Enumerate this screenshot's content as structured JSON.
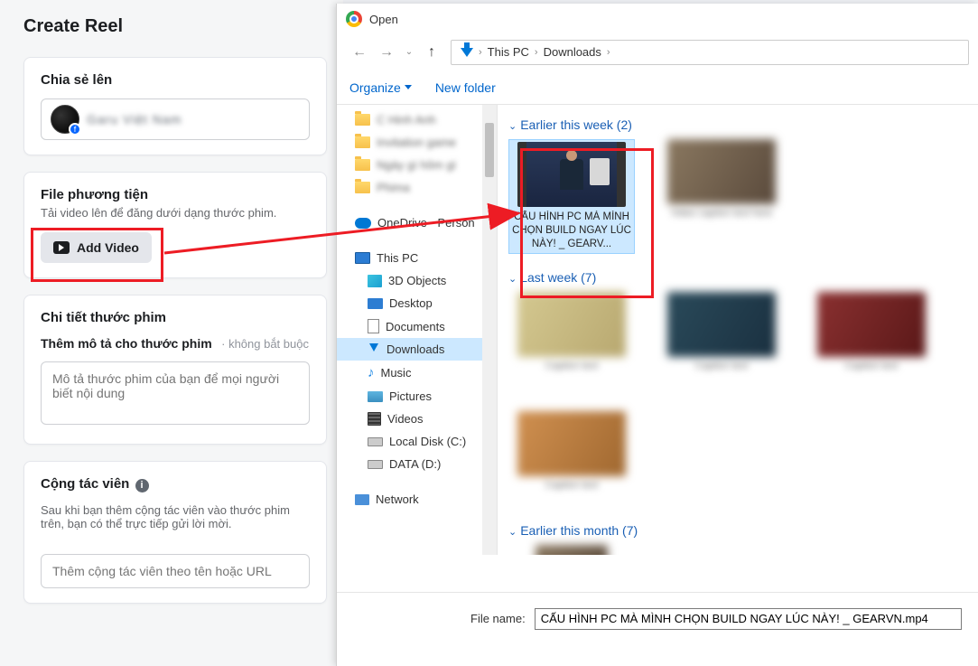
{
  "page": {
    "title": "Create Reel"
  },
  "share": {
    "heading": "Chia sẻ lên",
    "account": "Garu Việt Nam"
  },
  "media": {
    "heading": "File phương tiện",
    "subtitle": "Tải video lên để đăng dưới dạng thước phim.",
    "add_btn": "Add Video"
  },
  "details": {
    "heading": "Chi tiết thước phim",
    "desc_label": "Thêm mô tả cho thước phim",
    "optional": "không bắt buộc",
    "desc_placeholder": "Mô tả thước phim của bạn để mọi người biết nội dung"
  },
  "collab": {
    "heading": "Cộng tác viên",
    "text": "Sau khi bạn thêm cộng tác viên vào thước phim trên, bạn có thể trực tiếp gửi lời mời.",
    "placeholder": "Thêm cộng tác viên theo tên hoặc URL"
  },
  "dialog": {
    "title": "Open",
    "crumbs": [
      "This PC",
      "Downloads"
    ],
    "toolbar": {
      "organize": "Organize",
      "newfolder": "New folder"
    },
    "sidebar": {
      "onedrive": "OneDrive - Person",
      "thispc": "This PC",
      "obj3d": "3D Objects",
      "desktop": "Desktop",
      "documents": "Documents",
      "downloads": "Downloads",
      "music": "Music",
      "pictures": "Pictures",
      "videos": "Videos",
      "localdisk": "Local Disk (C:)",
      "data": "DATA (D:)",
      "network": "Network"
    },
    "groups": {
      "g1": "Earlier this week (2)",
      "g2": "Last week (7)",
      "g3": "Earlier this month (7)"
    },
    "selected_caption": "CẤU HÌNH PC MÀ MÌNH CHỌN BUILD NGAY LÚC NÀY! _ GEARV...",
    "filename_label": "File name:",
    "filename_value": "CẤU HÌNH PC MÀ MÌNH CHỌN BUILD NGAY LÚC NÀY! _ GEARVN.mp4"
  }
}
